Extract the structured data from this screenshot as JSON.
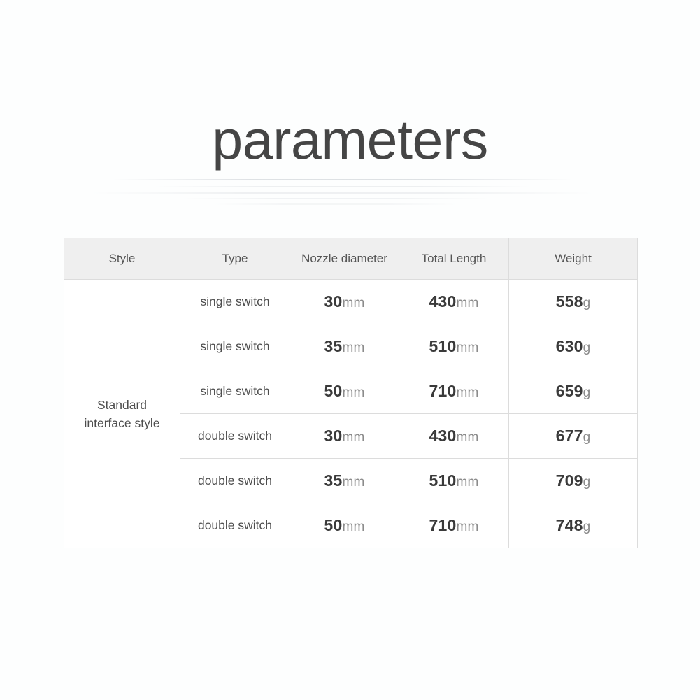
{
  "title": "parameters",
  "colors": {
    "page_background": "#fdfefe",
    "header_background": "#efefef",
    "border": "#dcdcdc",
    "title_text": "#454545",
    "header_text": "#555555",
    "value_text": "#3a3a3a",
    "unit_text": "#8b8b8b"
  },
  "table": {
    "headers": [
      "Style",
      "Type",
      "Nozzle diameter",
      "Total Length",
      "Weight"
    ],
    "style_group": "Standard interface style",
    "style_group_lines": [
      "Standard",
      "interface style"
    ],
    "rows": [
      {
        "type": "single switch",
        "nozzle_value": "30",
        "nozzle_unit": "mm",
        "length_value": "430",
        "length_unit": "mm",
        "weight_value": "558",
        "weight_unit": "g"
      },
      {
        "type": "single switch",
        "nozzle_value": "35",
        "nozzle_unit": "mm",
        "length_value": "510",
        "length_unit": "mm",
        "weight_value": "630",
        "weight_unit": "g"
      },
      {
        "type": "single switch",
        "nozzle_value": "50",
        "nozzle_unit": "mm",
        "length_value": "710",
        "length_unit": "mm",
        "weight_value": "659",
        "weight_unit": "g"
      },
      {
        "type": "double switch",
        "nozzle_value": "30",
        "nozzle_unit": "mm",
        "length_value": "430",
        "length_unit": "mm",
        "weight_value": "677",
        "weight_unit": "g"
      },
      {
        "type": "double switch",
        "nozzle_value": "35",
        "nozzle_unit": "mm",
        "length_value": "510",
        "length_unit": "mm",
        "weight_value": "709",
        "weight_unit": "g"
      },
      {
        "type": "double switch",
        "nozzle_value": "50",
        "nozzle_unit": "mm",
        "length_value": "710",
        "length_unit": "mm",
        "weight_value": "748",
        "weight_unit": "g"
      }
    ]
  }
}
